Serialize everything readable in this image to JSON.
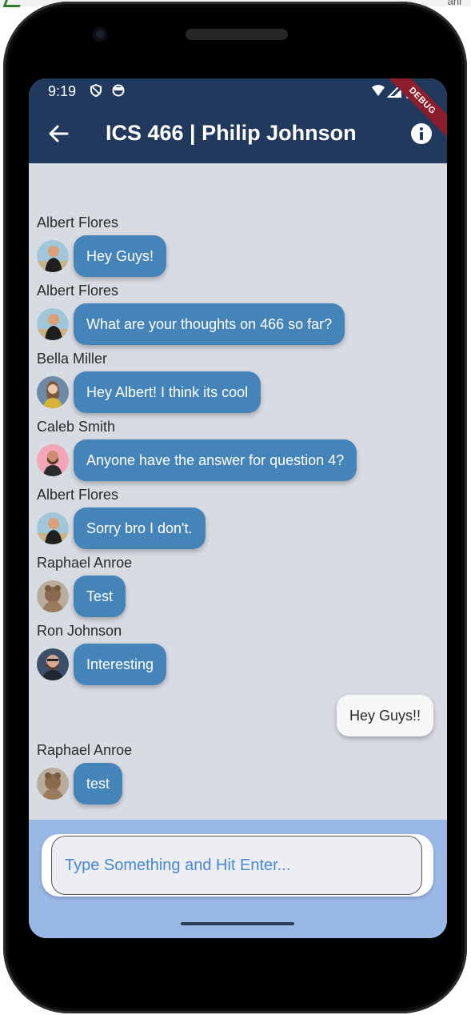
{
  "status_bar": {
    "time": "9:19",
    "debug_label": "DEBUG"
  },
  "header": {
    "title": "ICS 466 | Philip Johnson",
    "back_icon": "arrow-left-icon",
    "info_icon": "info-icon"
  },
  "messages": [
    {
      "sender": "Albert Flores",
      "text": "Hey Guys!",
      "avatar": "albert"
    },
    {
      "sender": "Albert Flores",
      "text": "What are your thoughts on 466 so far?",
      "avatar": "albert"
    },
    {
      "sender": "Bella Miller",
      "text": "Hey Albert! I think its cool",
      "avatar": "bella"
    },
    {
      "sender": "Caleb Smith",
      "text": "Anyone have the answer for question 4?",
      "avatar": "caleb"
    },
    {
      "sender": "Albert Flores",
      "text": "Sorry bro I don't.",
      "avatar": "albert"
    },
    {
      "sender": "Raphael Anroe",
      "text": "Test",
      "avatar": "raphael"
    },
    {
      "sender": "Ron Johnson",
      "text": "Interesting",
      "avatar": "ron"
    }
  ],
  "my_message": {
    "text": "Hey Guys!!"
  },
  "last_message": {
    "sender": "Raphael Anroe",
    "text": "test",
    "avatar": "raphael"
  },
  "composer": {
    "placeholder": "Type Something and Hit Enter..."
  },
  "colors": {
    "header_bg": "#22395e",
    "chat_bg": "#d7dbe2",
    "bubble_other": "#4484b8",
    "bubble_me": "#f7f7f8",
    "composer_bg": "#9ab8e6"
  }
}
